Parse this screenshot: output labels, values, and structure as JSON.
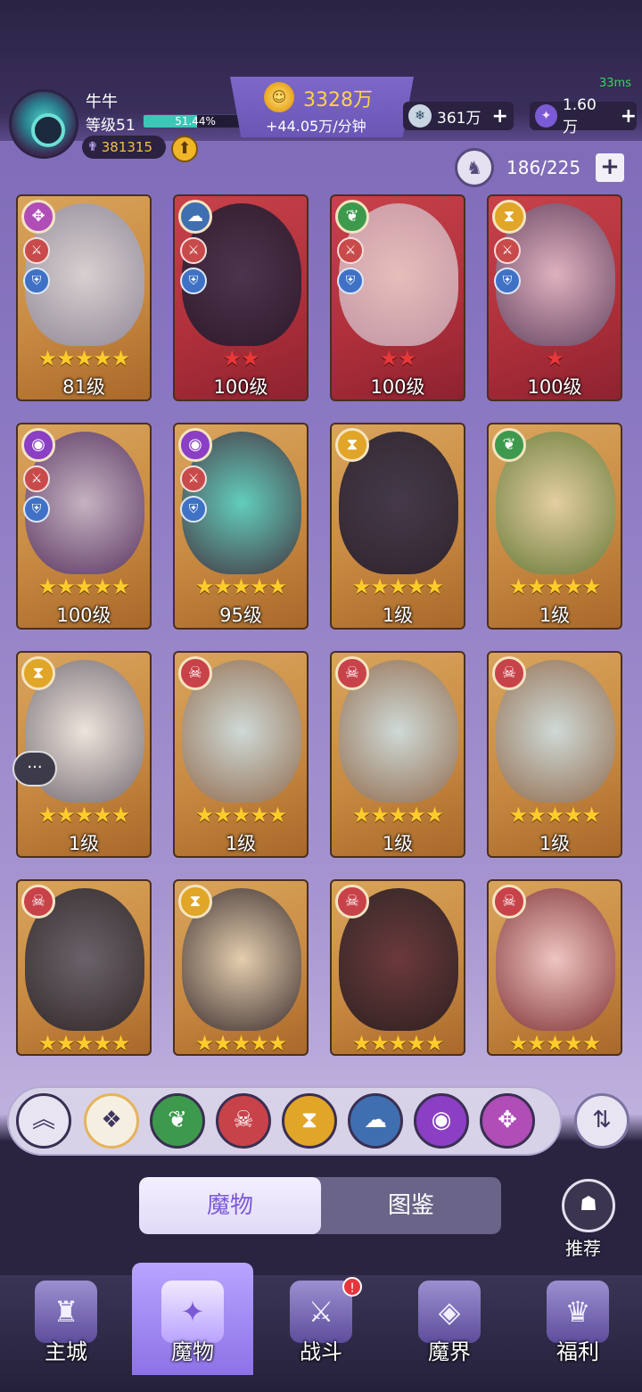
{
  "header": {
    "latency": "33ms",
    "player_name": "牛牛",
    "level": "等级51",
    "xp_percent": "51.44%",
    "xp_fraction": 0.5144,
    "combat_power": "381315",
    "gold_amount": "3328万",
    "gold_rate": "+44.05万/分钟",
    "gems": "361万",
    "stars": "1.60万"
  },
  "roster": {
    "count": "186/225"
  },
  "cards": [
    {
      "level": "81级",
      "stars": "★★★★★",
      "star_color": "gold"
    },
    {
      "level": "100级",
      "stars": "★★",
      "star_color": "red"
    },
    {
      "level": "100级",
      "stars": "★★",
      "star_color": "red"
    },
    {
      "level": "100级",
      "stars": "★",
      "star_color": "red"
    },
    {
      "level": "100级",
      "stars": "★★★★★",
      "star_color": "gold"
    },
    {
      "level": "95级",
      "stars": "★★★★★",
      "star_color": "gold"
    },
    {
      "level": "1级",
      "stars": "★★★★★",
      "star_color": "gold"
    },
    {
      "level": "1级",
      "stars": "★★★★★",
      "star_color": "gold"
    },
    {
      "level": "1级",
      "stars": "★★★★★",
      "star_color": "gold"
    },
    {
      "level": "1级",
      "stars": "★★★★★",
      "star_color": "gold"
    },
    {
      "level": "1级",
      "stars": "★★★★★",
      "star_color": "gold"
    },
    {
      "level": "1级",
      "stars": "★★★★★",
      "star_color": "gold"
    },
    {
      "level": "",
      "stars": "★★★★★",
      "star_color": "gold"
    },
    {
      "level": "",
      "stars": "★★★★★",
      "star_color": "gold"
    },
    {
      "level": "",
      "stars": "★★★★★",
      "star_color": "gold"
    },
    {
      "level": "",
      "stars": "★★★★★",
      "star_color": "gold"
    }
  ],
  "tabs": {
    "active": "魔物",
    "inactive": "图鉴"
  },
  "recommend_label": "推荐",
  "nav": [
    "主城",
    "魔物",
    "战斗",
    "魔界",
    "福利"
  ],
  "nav_badge": "!",
  "colors": {
    "accent": "#7b5ad6",
    "gold_text": "#ffd24a",
    "star_gold": "#ffcc2b",
    "star_red": "#e83838"
  }
}
